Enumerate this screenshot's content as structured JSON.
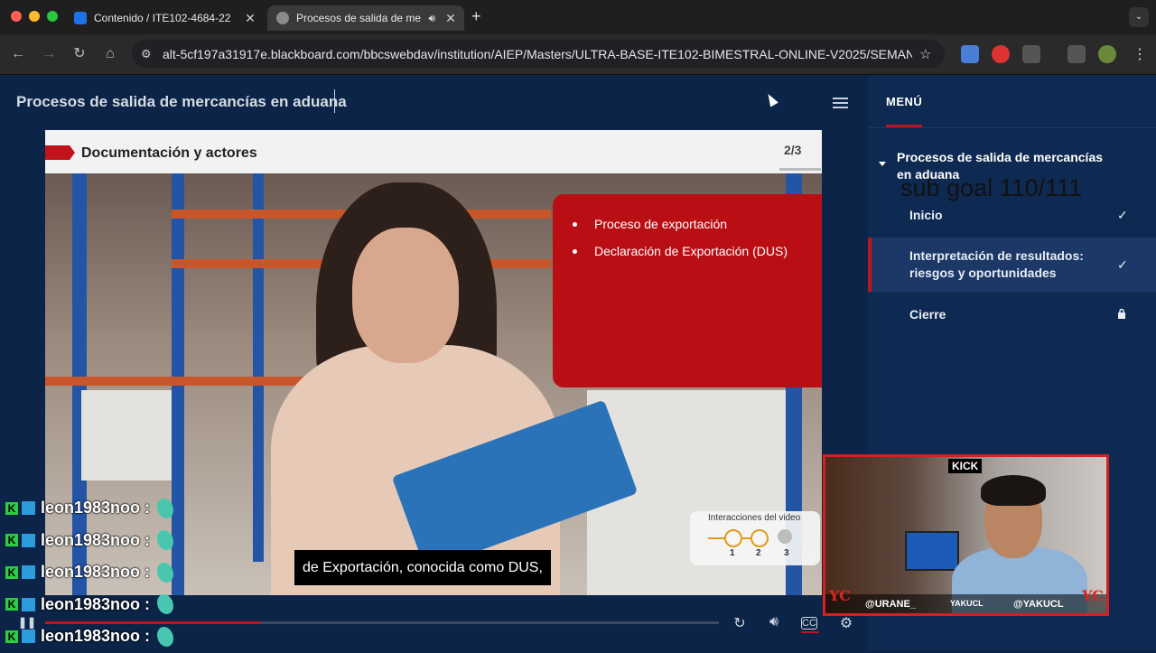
{
  "browser": {
    "tabs": [
      {
        "title": "Contenido / ITE102-4684-22",
        "active": false
      },
      {
        "title": "Procesos de salida de me",
        "active": true
      }
    ],
    "new_tab": "+",
    "url": "alt-5cf197a31917e.blackboard.com/bbcswebdav/institution/AIEP/Masters/ULTRA-BASE-ITE102-BIMESTRAL-ONLINE-V2025/SEMAN..."
  },
  "app": {
    "title": "Procesos de salida de mercancías en aduana"
  },
  "slide": {
    "header": "Documentación y actores",
    "page": "2/3",
    "bullets": [
      "Proceso de exportación",
      "Declaración de Exportación (DUS)"
    ],
    "caption": "de Exportación, conocida como DUS,",
    "interactions": {
      "title": "Interacciones del video",
      "steps": [
        {
          "num": "1",
          "done": true
        },
        {
          "num": "2",
          "done": true
        },
        {
          "num": "3",
          "done": false
        }
      ]
    },
    "progress": 0.32
  },
  "sidebar": {
    "menu_label": "MENÚ",
    "section_title": "Procesos de salida de mercancías en aduana",
    "overlay_text": "sub goal 110/111",
    "items": [
      {
        "label": "Inicio",
        "status": "✓",
        "active": false
      },
      {
        "label": "Interpretación de resultados: riesgos y oportunidades",
        "status": "✓",
        "active": true
      },
      {
        "label": "Cierre",
        "status": "lock",
        "active": false
      }
    ]
  },
  "chat": {
    "username": "leon1983noo :",
    "rows": 5
  },
  "webcam": {
    "platform": "KICK",
    "handle_left": "@URANE_",
    "handle_center": "YAKUCL",
    "handle_right": "@YAKUCL",
    "brand": "YC"
  },
  "colors": {
    "accent_red": "#c0131b",
    "navy": "#0b2447",
    "sidebar": "#0f2a52"
  }
}
